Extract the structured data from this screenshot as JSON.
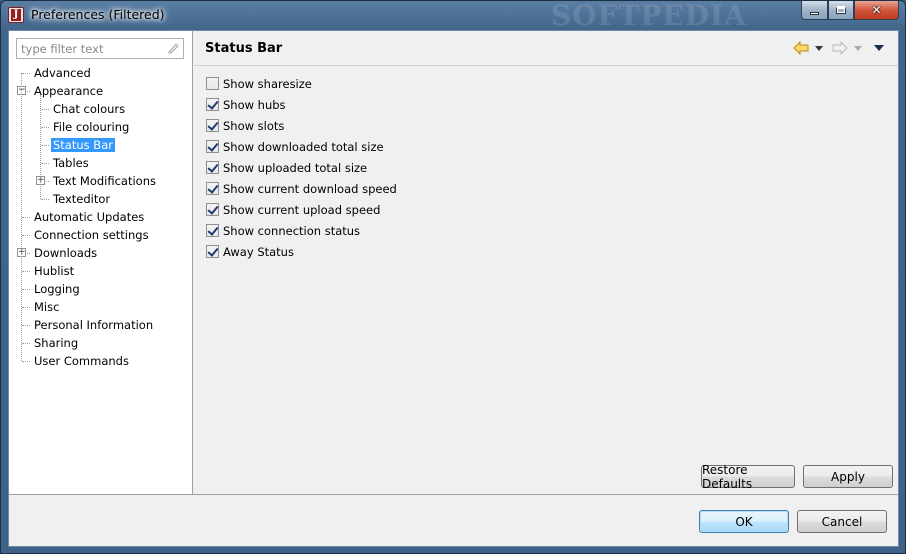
{
  "window": {
    "title": "Preferences (Filtered)",
    "watermark": "SOFTPEDIA",
    "app_icon_letter": "J"
  },
  "filter": {
    "placeholder": "type filter text"
  },
  "tree": {
    "items": [
      {
        "label": "Advanced",
        "level": 0
      },
      {
        "label": "Appearance",
        "level": 0,
        "expanded": true
      },
      {
        "label": "Chat colours",
        "level": 1
      },
      {
        "label": "File colouring",
        "level": 1
      },
      {
        "label": "Status Bar",
        "level": 1,
        "selected": true
      },
      {
        "label": "Tables",
        "level": 1
      },
      {
        "label": "Text Modifications",
        "level": 1,
        "collapsed": true
      },
      {
        "label": "Texteditor",
        "level": 1
      },
      {
        "label": "Automatic Updates",
        "level": 0
      },
      {
        "label": "Connection settings",
        "level": 0
      },
      {
        "label": "Downloads",
        "level": 0,
        "collapsed": true
      },
      {
        "label": "Hublist",
        "level": 0
      },
      {
        "label": "Logging",
        "level": 0
      },
      {
        "label": "Misc",
        "level": 0
      },
      {
        "label": "Personal Information",
        "level": 0
      },
      {
        "label": "Sharing",
        "level": 0
      },
      {
        "label": "User Commands",
        "level": 0
      }
    ]
  },
  "page": {
    "title": "Status Bar",
    "options": [
      {
        "label": "Show sharesize",
        "checked": false
      },
      {
        "label": "Show hubs",
        "checked": true
      },
      {
        "label": "Show slots",
        "checked": true
      },
      {
        "label": "Show downloaded total size",
        "checked": true
      },
      {
        "label": "Show uploaded total size",
        "checked": true
      },
      {
        "label": "Show current download speed",
        "checked": true
      },
      {
        "label": "Show current upload speed",
        "checked": true
      },
      {
        "label": "Show connection status",
        "checked": true
      },
      {
        "label": "Away Status",
        "checked": true
      }
    ],
    "restore_defaults": "Restore Defaults",
    "apply": "Apply"
  },
  "dialog": {
    "ok": "OK",
    "cancel": "Cancel"
  },
  "colors": {
    "selection": "#3399ff",
    "title_bar": "#40648a",
    "close_button": "#c0391f"
  }
}
